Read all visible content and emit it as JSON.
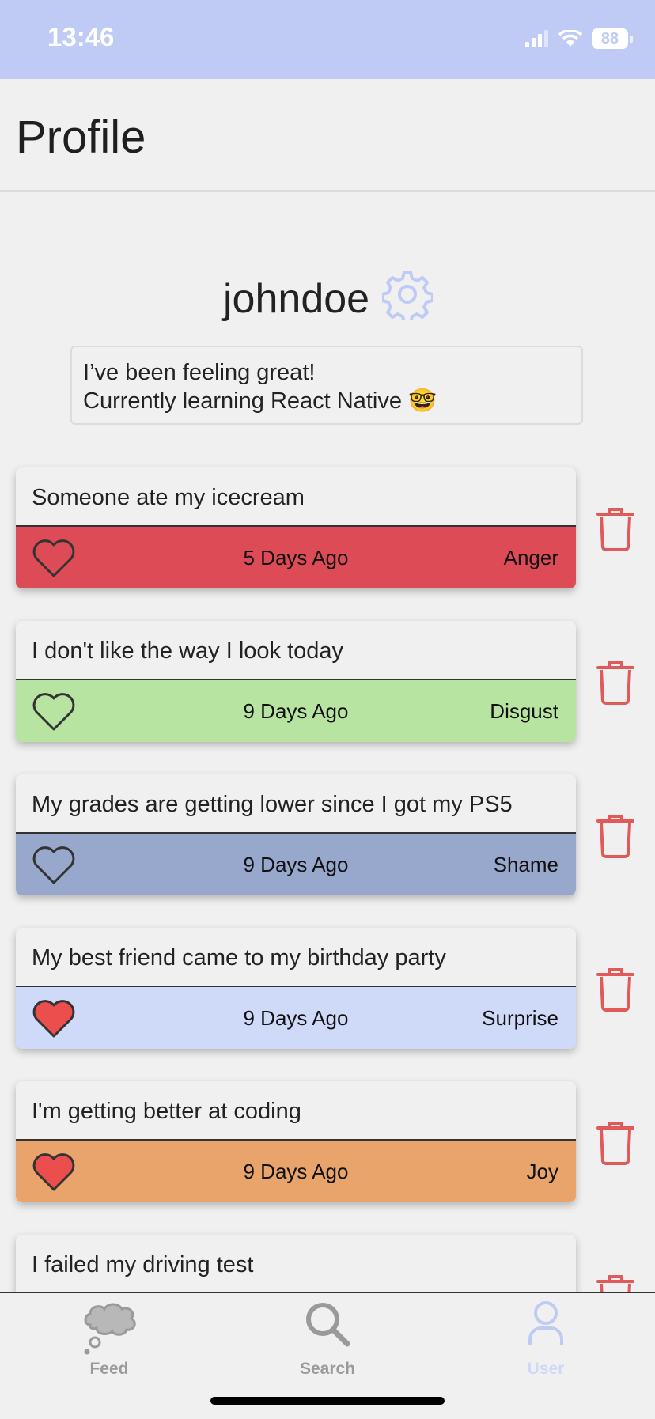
{
  "status": {
    "time": "13:46",
    "battery": "88"
  },
  "header": {
    "title": "Profile"
  },
  "profile": {
    "username": "johndoe",
    "bio_line1": "I’ve been feeling great!",
    "bio_line2": "Currently learning React Native 🤓"
  },
  "posts": [
    {
      "text": "Someone ate my icecream",
      "date": "5 Days Ago",
      "emotion": "Anger",
      "color": "#dc4b56",
      "liked": false
    },
    {
      "text": "I don't like the way I look today",
      "date": "9 Days Ago",
      "emotion": "Disgust",
      "color": "#b8e4a2",
      "liked": false
    },
    {
      "text": "My grades are getting lower since I got my PS5",
      "date": "9 Days Ago",
      "emotion": "Shame",
      "color": "#98a7cc",
      "liked": false
    },
    {
      "text": "My best friend came to my birthday party",
      "date": "9 Days Ago",
      "emotion": "Surprise",
      "color": "#cfdaf9",
      "liked": true
    },
    {
      "text": "I'm getting better at coding",
      "date": "9 Days Ago",
      "emotion": "Joy",
      "color": "#e8a46a",
      "liked": true
    },
    {
      "text": "I failed my driving test"
    }
  ],
  "tabs": [
    {
      "label": "Feed",
      "icon": "thought-cloud-icon"
    },
    {
      "label": "Search",
      "icon": "search-icon"
    },
    {
      "label": "User",
      "icon": "user-icon",
      "active": true
    }
  ],
  "colors": {
    "accent": "#bfcbf5",
    "trash": "#e05a5a",
    "heart_filled": "#ec4e4e",
    "tab_inactive": "#9a9a9a"
  }
}
